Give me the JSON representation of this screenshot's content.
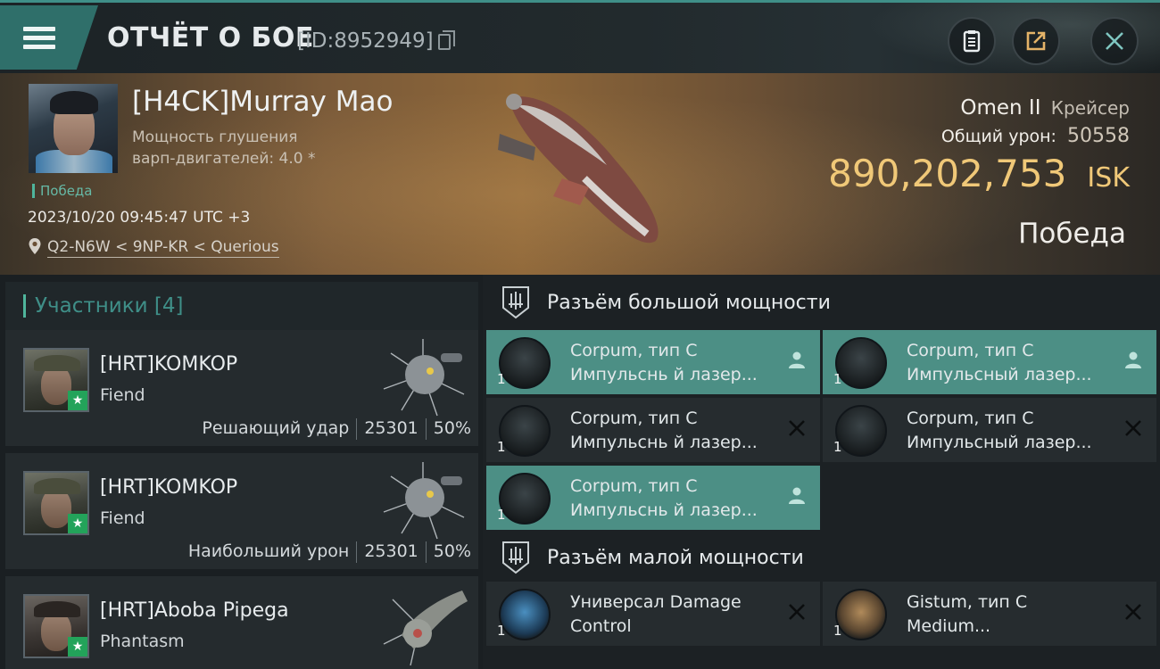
{
  "header": {
    "title": "ОТЧЁТ О БОЕ",
    "battle_id": "[ID:8952949]",
    "icons": [
      "menu-icon",
      "copy-icon",
      "clipboard-icon",
      "share-icon",
      "close-icon"
    ]
  },
  "victim": {
    "name": "[H4CK]Murray Mao",
    "stat_line1": "Мощность глушения",
    "stat_line2": "варп-двигателей: 4.0 *",
    "flag": "Победа",
    "datetime": "2023/10/20 09:45:47 UTC +3",
    "location": "Q2-N6W < 9NP-KR < Querious",
    "ship_name": "Omen II",
    "ship_class": "Крейсер",
    "damage_label": "Общий урон:",
    "damage_value": "50558",
    "isk_value": "890,202,753",
    "isk_unit": "ISK",
    "result": "Победа"
  },
  "participants": {
    "header": "Участники [4]",
    "rows": [
      {
        "name": "[HRT]KOMKOP",
        "ship": "Fiend",
        "label": "Решающий удар",
        "damage": "25301",
        "percent": "50%"
      },
      {
        "name": "[HRT]KOMKOP",
        "ship": "Fiend",
        "label": "Наибольший урон",
        "damage": "25301",
        "percent": "50%"
      },
      {
        "name": "[HRT]Aboba Pipega",
        "ship": "Phantasm",
        "label": "",
        "damage": "",
        "percent": ""
      }
    ]
  },
  "high_slots": {
    "header": "Разъём большой мощности",
    "items": [
      {
        "qty": "1",
        "line1": "Corpum, тип C",
        "line2": "Импульснь й лазер...",
        "state": "person-icon",
        "active": true
      },
      {
        "qty": "1",
        "line1": "Corpum, тип C",
        "line2": "Импульсный лазер...",
        "state": "person-icon",
        "active": true
      },
      {
        "qty": "1",
        "line1": "Corpum, тип C",
        "line2": "Импульснь й лазер...",
        "state": "destroyed-icon",
        "active": false
      },
      {
        "qty": "1",
        "line1": "Corpum, тип C",
        "line2": "Импульсный лазер...",
        "state": "destroyed-icon",
        "active": false
      },
      {
        "qty": "1",
        "line1": "Corpum, тип C",
        "line2": "Импульснь й лазер...",
        "state": "person-icon",
        "active": true
      }
    ]
  },
  "low_slots": {
    "header": "Разъём малой мощности",
    "items": [
      {
        "qty": "1",
        "line1": "Универсал Damage",
        "line2": "Control",
        "state": "destroyed-icon",
        "active": false
      },
      {
        "qty": "1",
        "line1": "Gistum, тип C",
        "line2": "Medium...",
        "state": "destroyed-icon",
        "active": false
      }
    ]
  },
  "colors": {
    "accent": "#3f8f88",
    "active_slot": "#4c8f85",
    "isk": "#f0c878",
    "victory": "#4fb59c",
    "npc_star": "#23a35a"
  }
}
